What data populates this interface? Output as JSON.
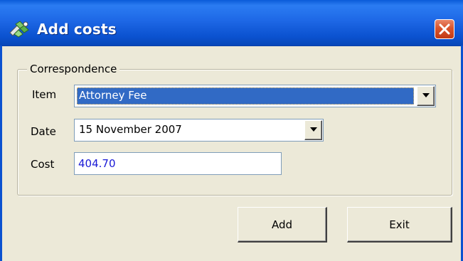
{
  "window": {
    "title": "Add costs",
    "icon": "add-costs-app-icon",
    "close_icon": "close-icon"
  },
  "group": {
    "legend": "Correspondence"
  },
  "fields": {
    "item_label": "Item",
    "item_value": "Attorney Fee",
    "date_label": "Date",
    "date_value": "15 November 2007",
    "cost_label": "Cost",
    "cost_value": "404.70"
  },
  "buttons": {
    "add_label": "Add",
    "exit_label": "Exit"
  },
  "colors": {
    "titlebar": "#0b52d0",
    "selection": "#316ac5",
    "cost_text": "#1a1ad6",
    "close_button": "#d9542c"
  }
}
